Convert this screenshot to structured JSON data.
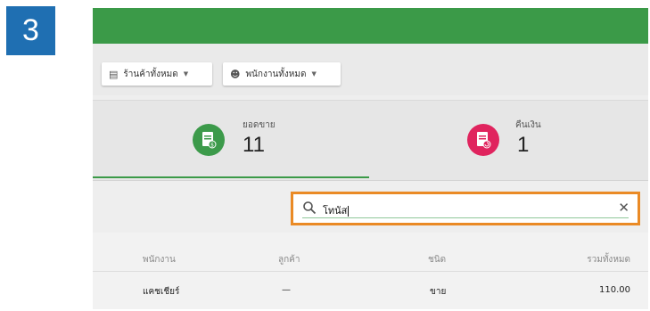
{
  "step_number": "3",
  "filters": {
    "store_label": "ร้านค้าทั้งหมด",
    "employee_label": "พนักงานทั้งหมด"
  },
  "stats": {
    "sales": {
      "label": "ยอดขาย",
      "value": "11",
      "icon": "receipt-dollar-icon",
      "color": "#3c9a4a"
    },
    "refunds": {
      "label": "คืนเงิน",
      "value": "1",
      "icon": "receipt-refund-icon",
      "color": "#e0245e"
    }
  },
  "search": {
    "value": "โทนัส",
    "icon": "search-icon",
    "clear_icon": "close-icon"
  },
  "table": {
    "columns": [
      "พนักงาน",
      "ลูกค้า",
      "ชนิด",
      "รวมทั้งหมด"
    ],
    "rows": [
      [
        "แคชเชียร์",
        "—",
        "ขาย",
        "110.00"
      ]
    ]
  },
  "colors": {
    "brand_green": "#3b9a48",
    "highlight_orange": "#ea8a25",
    "step_blue": "#1f6fb2"
  }
}
